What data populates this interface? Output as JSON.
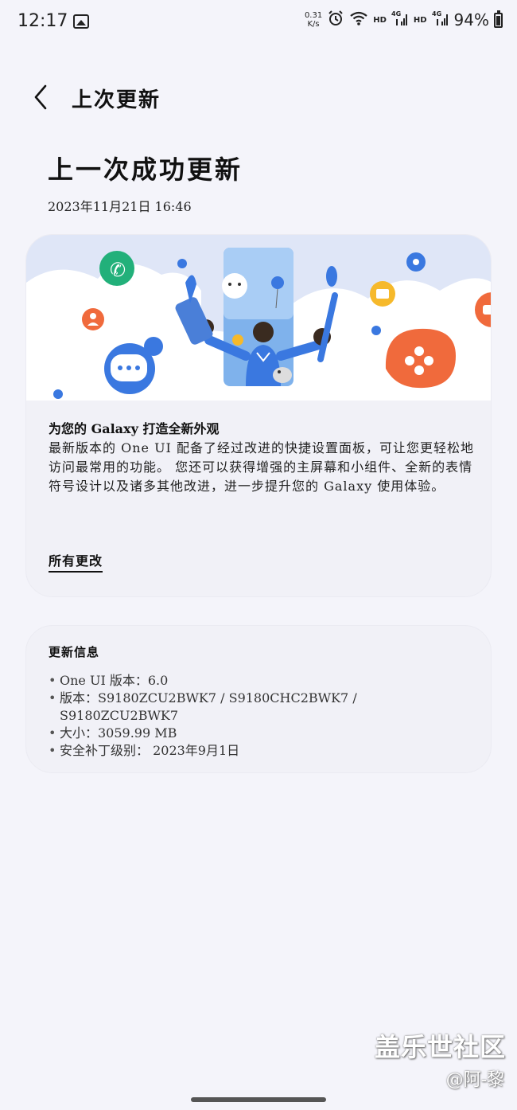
{
  "status_bar": {
    "time": "12:17",
    "net_speed_value": "0.31",
    "net_speed_unit": "K/s",
    "hd1": "HD",
    "lte1": "4G",
    "hd2": "HD",
    "lte2": "4G",
    "battery": "94%"
  },
  "header": {
    "title": "上次更新"
  },
  "main": {
    "title": "上一次成功更新",
    "date": "2023年11月21日  16:46"
  },
  "feature_card": {
    "heading": "为您的 Galaxy 打造全新外观",
    "body": "最新版本的 One UI 配备了经过改进的快捷设置面板，可让您更轻松地访问最常用的功能。 您还可以获得增强的主屏幕和小组件、全新的表情符号设计以及诸多其他改进，进一步提升您的 Galaxy 使用体验。",
    "all_changes_link": "所有更改"
  },
  "info_card": {
    "title": "更新信息",
    "items": [
      "One UI 版本：6.0",
      "版本：S9180ZCU2BWK7 / S9180CHC2BWK7 / S9180ZCU2BWK7",
      "大小：3059.99 MB",
      "安全补丁级别： 2023年9月1日"
    ]
  },
  "watermark": {
    "logo": "盖乐世社区",
    "user": "@阿-黎"
  },
  "colors": {
    "background": "#f4f4fa",
    "card": "#f1f1f7",
    "banner_sky": "#dfe6f7",
    "accent_blue": "#3a78e0",
    "accent_orange": "#f06a3c",
    "accent_yellow": "#f6b92b",
    "accent_green": "#22b07a"
  }
}
